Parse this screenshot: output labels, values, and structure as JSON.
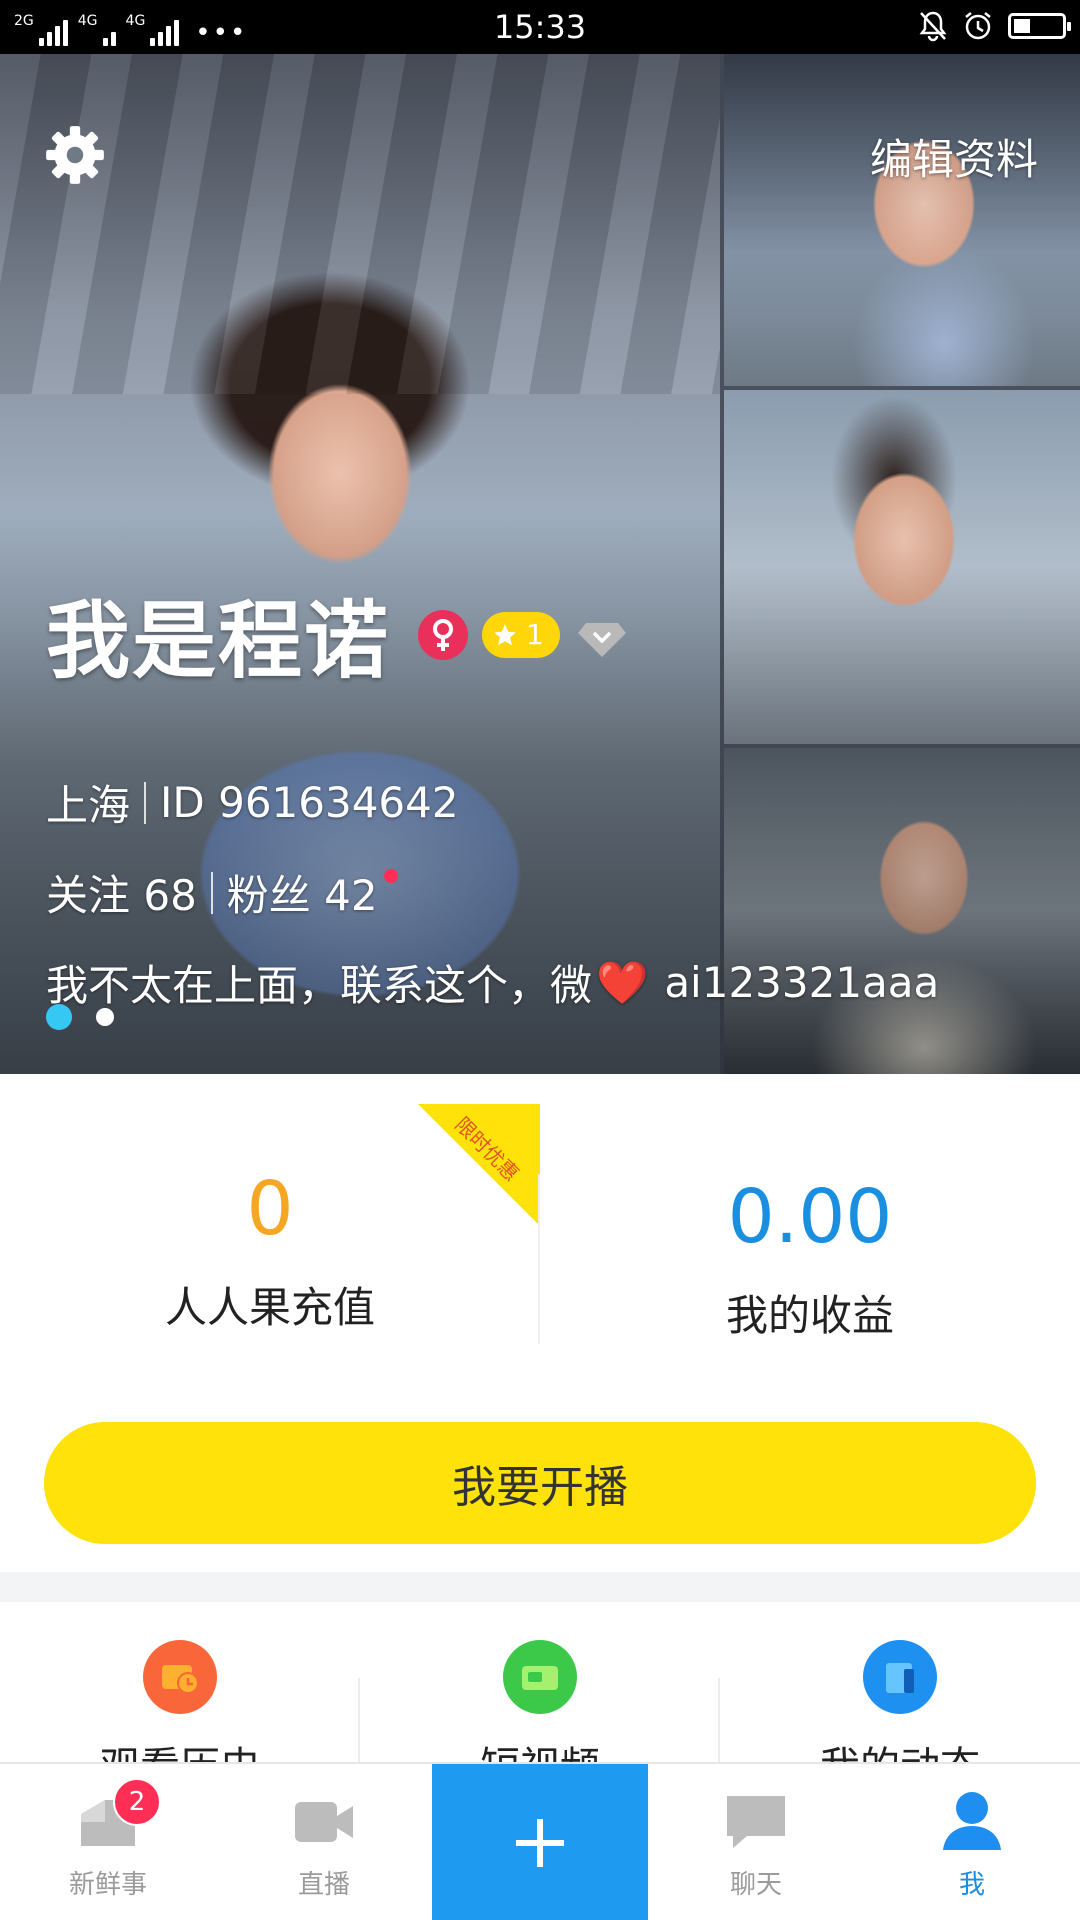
{
  "status_bar": {
    "net1": "2G",
    "net2": "4G",
    "net3": "4G",
    "more": "•••",
    "time": "15:33"
  },
  "profile": {
    "edit_label": "编辑资料",
    "name": "我是程诺",
    "level": "1",
    "city": "上海",
    "id_text": "ID 961634642",
    "following": "关注 68",
    "fans": "粉丝 42",
    "bio_prefix": "我不太在上面，联系这个，微",
    "bio_suffix": "ai123321aaa",
    "heart_emoji": "❤️",
    "page_count": 2,
    "current_page": 1
  },
  "wallet": {
    "recharge_value": "0",
    "recharge_label": "人人果充值",
    "promo_label": "限时优惠",
    "earnings_value": "0.00",
    "earnings_label": "我的收益"
  },
  "live_button": "我要开播",
  "shortcuts": [
    {
      "label": "观看历史",
      "icon": "history-icon",
      "color": "#f9663a"
    },
    {
      "label": "短视频",
      "icon": "video-icon",
      "color": "#3cc94a"
    },
    {
      "label": "我的动态",
      "icon": "moments-icon",
      "color": "#1e90f0"
    }
  ],
  "tabs": [
    {
      "label": "新鲜事",
      "icon": "feed-icon",
      "badge": "2"
    },
    {
      "label": "直播",
      "icon": "live-camera-icon"
    },
    {
      "label": "",
      "icon": "plus-icon"
    },
    {
      "label": "聊天",
      "icon": "chat-icon"
    },
    {
      "label": "我",
      "icon": "profile-icon",
      "active": true
    }
  ],
  "colors": {
    "accent_blue": "#1e9bf0",
    "live_yellow": "#ffe20a",
    "recharge_orange": "#f5a623",
    "badge_red": "#ff2e55"
  }
}
